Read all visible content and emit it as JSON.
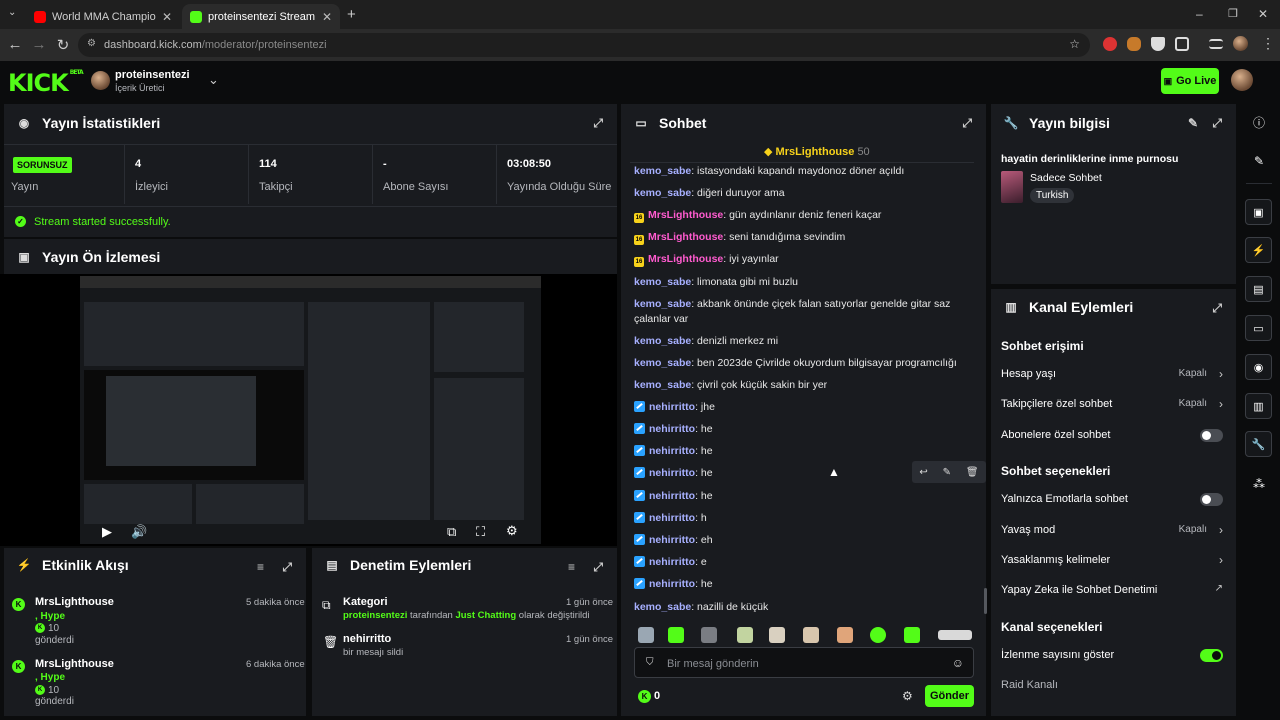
{
  "browser": {
    "tabs": [
      {
        "title": "World MMA Championship Ant",
        "active": false,
        "favicon_color": "#ff0000"
      },
      {
        "title": "proteinsentezi Stream - Kick Da",
        "active": true,
        "favicon_color": "#53fc18"
      }
    ],
    "new_tab_symbol": "+",
    "url_host": "dashboard.kick.com",
    "url_path": "/moderator/proteinsentezi",
    "window_controls": [
      "–",
      "❐",
      "✕"
    ]
  },
  "header": {
    "logo": "KICK",
    "logo_badge": "BETA",
    "user_name": "proteinsentezi",
    "user_role": "İçerik Üretici",
    "go_live": "Go Live"
  },
  "stats": {
    "title": "Yayın İstatistikleri",
    "status_badge": "SORUNSUZ",
    "status_label": "Yayın",
    "cells": [
      {
        "value": "4",
        "label": "İzleyici"
      },
      {
        "value": "114",
        "label": "Takipçi"
      },
      {
        "value": "-",
        "label": "Abone Sayısı"
      },
      {
        "value": "03:08:50",
        "label": "Yayında Olduğu Süre"
      }
    ],
    "success_message": "Stream started successfully."
  },
  "preview": {
    "title": "Yayın Ön İzlemesi"
  },
  "activity": {
    "title": "Etkinlik Akışı",
    "items": [
      {
        "name": "MrsLighthouse",
        "kind": ", Hype",
        "amount": "10",
        "action": "gönderdi",
        "time": "5 dakika önce"
      },
      {
        "name": "MrsLighthouse",
        "kind": ", Hype",
        "amount": "10",
        "action": "gönderdi",
        "time": "6 dakika önce"
      }
    ]
  },
  "moderation": {
    "title": "Denetim Eylemleri",
    "items": [
      {
        "title": "Kategori",
        "actor": "proteinsentezi",
        "text_mid": " tarafından ",
        "target": "Just Chatting",
        "text_end": " olarak değiştirildi",
        "time": "1 gün önce",
        "icon": "category-icon"
      },
      {
        "title": "nehirritto",
        "detail": "bir mesajı sildi",
        "time": "1 gün önce",
        "icon": "trash-icon"
      }
    ]
  },
  "chat": {
    "title": "Sohbet",
    "pinned_user": "MrsLighthouse",
    "pinned_count": "50",
    "messages": [
      {
        "user": "kemo_sabe",
        "badge": "",
        "text": ": istasyondaki kapandı maydonoz döner açıldı"
      },
      {
        "user": "kemo_sabe",
        "badge": "",
        "text": ": diğeri duruyor ama"
      },
      {
        "user": "MrsLighthouse",
        "badge": "16",
        "text": ": gün aydınlanır deniz feneri kaçar"
      },
      {
        "user": "MrsLighthouse",
        "badge": "16",
        "text": ": seni tanıdığıma sevindim"
      },
      {
        "user": "MrsLighthouse",
        "badge": "16",
        "text": ": iyi yayınlar"
      },
      {
        "user": "kemo_sabe",
        "badge": "",
        "text": ": limonata gibi mi buzlu"
      },
      {
        "user": "kemo_sabe",
        "badge": "",
        "text": ": akbank önünde çiçek falan satıyorlar genelde gitar saz çalanlar var"
      },
      {
        "user": "kemo_sabe",
        "badge": "",
        "text": ": denizli merkez mi"
      },
      {
        "user": "kemo_sabe",
        "badge": "",
        "text": ": ben 2023de Çivrilde okuyordum bilgisayar programcılığı"
      },
      {
        "user": "kemo_sabe",
        "badge": "",
        "text": ": çivril çok küçük sakin bir yer"
      },
      {
        "user": "nehirritto",
        "badge": "sub",
        "text": ": jhe"
      },
      {
        "user": "nehirritto",
        "badge": "sub",
        "text": ": he"
      },
      {
        "user": "nehirritto",
        "badge": "sub",
        "text": ": he"
      },
      {
        "user": "nehirritto",
        "badge": "sub",
        "text": ": he"
      },
      {
        "user": "nehirritto",
        "badge": "sub",
        "text": ": he"
      },
      {
        "user": "nehirritto",
        "badge": "sub",
        "text": ": h"
      },
      {
        "user": "nehirritto",
        "badge": "sub",
        "text": ": eh"
      },
      {
        "user": "nehirritto",
        "badge": "sub",
        "text": ": e"
      },
      {
        "user": "nehirritto",
        "badge": "sub",
        "text": ": he"
      },
      {
        "user": "kemo_sabe",
        "badge": "",
        "text": ": nazilli de küçük"
      }
    ],
    "input_placeholder": "Bir mesaj gönderin",
    "points": "0",
    "send": "Gönder"
  },
  "stream_info": {
    "title": "Yayın bilgisi",
    "stream_title": "hayatin derinliklerine inme purnosu",
    "chat_mode": "Sadece Sohbet",
    "language": "Turkish"
  },
  "channel_actions": {
    "title": "Kanal Eylemleri",
    "chat_access_header": "Sohbet erişimi",
    "account_age": {
      "label": "Hesap yaşı",
      "value": "Kapalı"
    },
    "followers_only": {
      "label": "Takipçilere özel sohbet",
      "value": "Kapalı"
    },
    "subscribers_only": {
      "label": "Abonelere özel sohbet"
    },
    "chat_options_header": "Sohbet seçenekleri",
    "emotes_only": {
      "label": "Yalnızca Emotlarla sohbet"
    },
    "slow_mode": {
      "label": "Yavaş mod",
      "value": "Kapalı"
    },
    "banned_words": {
      "label": "Yasaklanmış kelimeler"
    },
    "ai_moderation": {
      "label": "Yapay Zeka ile Sohbet Denetimi"
    },
    "channel_options_header": "Kanal seçenekleri",
    "show_viewers": {
      "label": "İzlenme sayısını göster"
    },
    "raid": {
      "label": "Raid Kanalı"
    }
  },
  "colors": {
    "accent": "#53fc18",
    "panel": "#191b1f",
    "background": "#0b0c0d",
    "mod_badge": "#f7d21b",
    "sub_badge": "#2aa2ff"
  }
}
